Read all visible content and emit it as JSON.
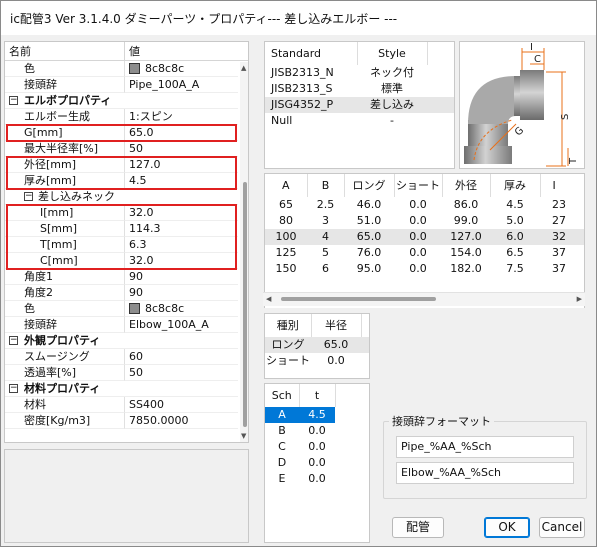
{
  "window": {
    "title": "ic配管3 Ver 3.1.4.0 ダミーパーツ・プロパティ--- 差し込みエルボー ---"
  },
  "propgrid": {
    "header": {
      "name": "名前",
      "value": "値"
    },
    "rows": [
      {
        "name": "色",
        "value": "8c8c8c",
        "swatch": "#8c8c8c"
      },
      {
        "name": "接頭辞",
        "value": "Pipe_100A_A"
      },
      {
        "category": "エルボプロパティ",
        "toggle": "−"
      },
      {
        "name": "エルボー生成",
        "value": "1:スピン"
      },
      {
        "name": "G[mm]",
        "value": "65.0"
      },
      {
        "name": "最大半径率[%]",
        "value": "50"
      },
      {
        "name": "外径[mm]",
        "value": "127.0"
      },
      {
        "name": "厚み[mm]",
        "value": "4.5"
      },
      {
        "subcategory": "差し込みネック",
        "toggle": "−"
      },
      {
        "name": "I[mm]",
        "value": "32.0"
      },
      {
        "name": "S[mm]",
        "value": "114.3"
      },
      {
        "name": "T[mm]",
        "value": "6.3"
      },
      {
        "name": "C[mm]",
        "value": "32.0"
      },
      {
        "name": "角度1",
        "value": "90"
      },
      {
        "name": "角度2",
        "value": "90"
      },
      {
        "name": "色",
        "value": "8c8c8c",
        "swatch": "#8c8c8c"
      },
      {
        "name": "接頭辞",
        "value": "Elbow_100A_A"
      },
      {
        "category": "外観プロパティ",
        "toggle": "−"
      },
      {
        "name": "スムージング",
        "value": "60"
      },
      {
        "name": "透過率[%]",
        "value": "50"
      },
      {
        "category": "材料プロパティ",
        "toggle": "−"
      },
      {
        "name": "材料",
        "value": "SS400"
      },
      {
        "name": "密度[Kg/m3]",
        "value": "7850.0000"
      }
    ]
  },
  "standards": {
    "headers": [
      "Standard",
      "Style"
    ],
    "rows": [
      [
        "JISB2313_N",
        "ネック付"
      ],
      [
        "JISB2313_S",
        "標準"
      ],
      [
        "JISG4352_P",
        "差し込み"
      ],
      [
        "Null",
        "-"
      ]
    ],
    "selected_index": 2
  },
  "diagram": {
    "labels": [
      "I",
      "C",
      "S",
      "G",
      "T"
    ],
    "accent": "#e8701a"
  },
  "sizes": {
    "headers": [
      "A",
      "B",
      "ロング",
      "ショート",
      "外径",
      "厚み",
      "I"
    ],
    "rows": [
      [
        "65",
        "2.5",
        "46.0",
        "0.0",
        "86.0",
        "4.5",
        "23"
      ],
      [
        "80",
        "3",
        "51.0",
        "0.0",
        "99.0",
        "5.0",
        "27"
      ],
      [
        "100",
        "4",
        "65.0",
        "0.0",
        "127.0",
        "6.0",
        "32"
      ],
      [
        "125",
        "5",
        "76.0",
        "0.0",
        "154.0",
        "6.5",
        "37"
      ],
      [
        "150",
        "6",
        "95.0",
        "0.0",
        "182.0",
        "7.5",
        "37"
      ]
    ],
    "selected_index": 2
  },
  "radius": {
    "headers": [
      "種別",
      "半径"
    ],
    "rows": [
      [
        "ロング",
        "65.0"
      ],
      [
        "ショート",
        "0.0"
      ]
    ],
    "selected_index": 0
  },
  "sch": {
    "headers": [
      "Sch",
      "t"
    ],
    "rows": [
      [
        "A",
        "4.5"
      ],
      [
        "B",
        "0.0"
      ],
      [
        "C",
        "0.0"
      ],
      [
        "D",
        "0.0"
      ],
      [
        "E",
        "0.0"
      ]
    ],
    "selected_index": 0
  },
  "prefix_format": {
    "label": "接頭辞フォーマット",
    "pipe": "Pipe_%AA_%Sch",
    "elbow": "Elbow_%AA_%Sch"
  },
  "buttons": {
    "pipe": "配管",
    "ok": "OK",
    "cancel": "Cancel"
  }
}
